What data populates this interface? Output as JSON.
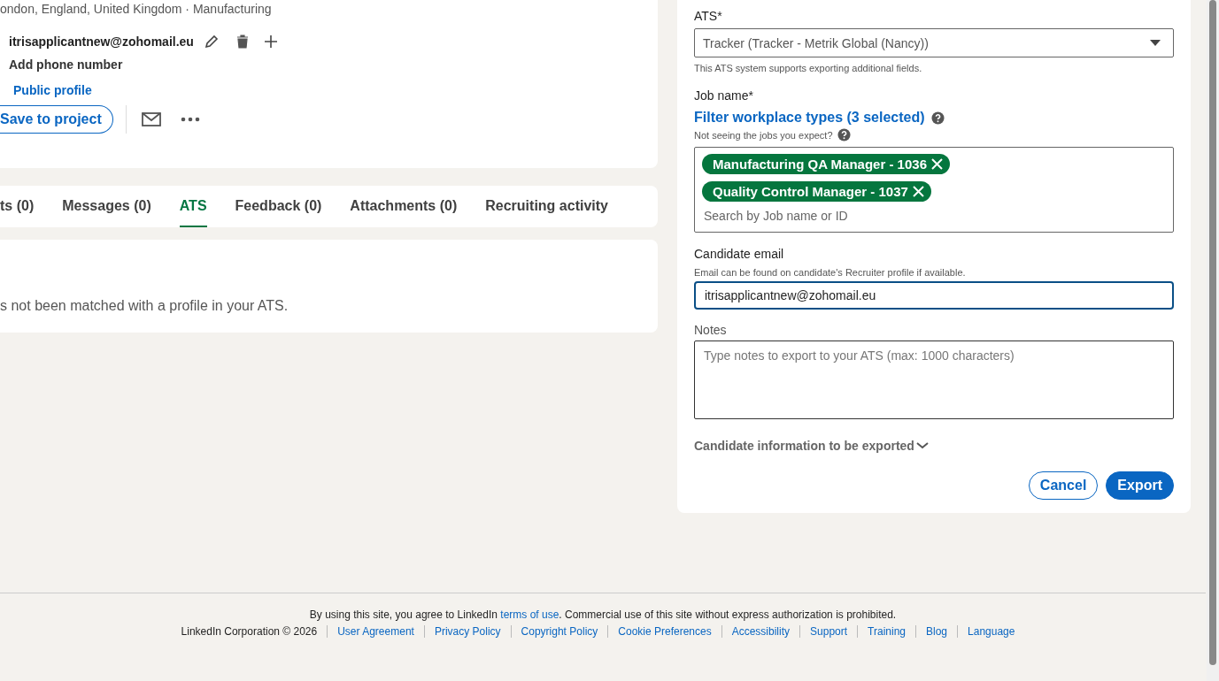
{
  "profile": {
    "location": "ondon, England, United Kingdom · Manufacturing",
    "email": "itrisapplicantnew@zohomail.eu",
    "phone_action": "Add phone number",
    "public_profile": "Public profile",
    "save_button": "Save to project"
  },
  "tabs": [
    {
      "label": "ts (0)",
      "selected": false
    },
    {
      "label": "Messages (0)",
      "selected": false
    },
    {
      "label": "ATS",
      "selected": true
    },
    {
      "label": "Feedback (0)",
      "selected": false
    },
    {
      "label": "Attachments (0)",
      "selected": false
    },
    {
      "label": "Recruiting activity",
      "selected": false
    }
  ],
  "ats_message": "s not been matched with a profile in your ATS.",
  "export_form": {
    "ats_label": "ATS*",
    "ats_value": "Tracker (Tracker - Metrik Global (Nancy))",
    "ats_hint": "This ATS system supports exporting additional fields.",
    "job_label": "Job name*",
    "filter_link": "Filter workplace types (3 selected)",
    "jobs_hint": "Not seeing the jobs you expect?",
    "selected_jobs": [
      {
        "label": "Manufacturing QA Manager - 1036"
      },
      {
        "label": "Quality Control Manager - 1037"
      }
    ],
    "job_search_placeholder": "Search by Job name or ID",
    "email_label": "Candidate email",
    "email_hint": "Email can be found on candidate's Recruiter profile if available.",
    "email_value": "itrisapplicantnew@zohomail.eu",
    "notes_label": "Notes",
    "notes_placeholder": "Type notes to export to your ATS (max: 1000 characters)",
    "expand_label": "Candidate information to be exported",
    "cancel_button": "Cancel",
    "export_button": "Export"
  },
  "footer": {
    "notice_before": "By using this site, you agree to LinkedIn ",
    "notice_link": "terms of use",
    "notice_after": ". Commercial use of this site without express authorization is prohibited.",
    "copyright": "LinkedIn Corporation © 2026",
    "links": [
      "User Agreement",
      "Privacy Policy",
      "Copyright Policy",
      "Cookie Preferences",
      "Accessibility",
      "Support",
      "Training",
      "Blog",
      "Language"
    ]
  }
}
